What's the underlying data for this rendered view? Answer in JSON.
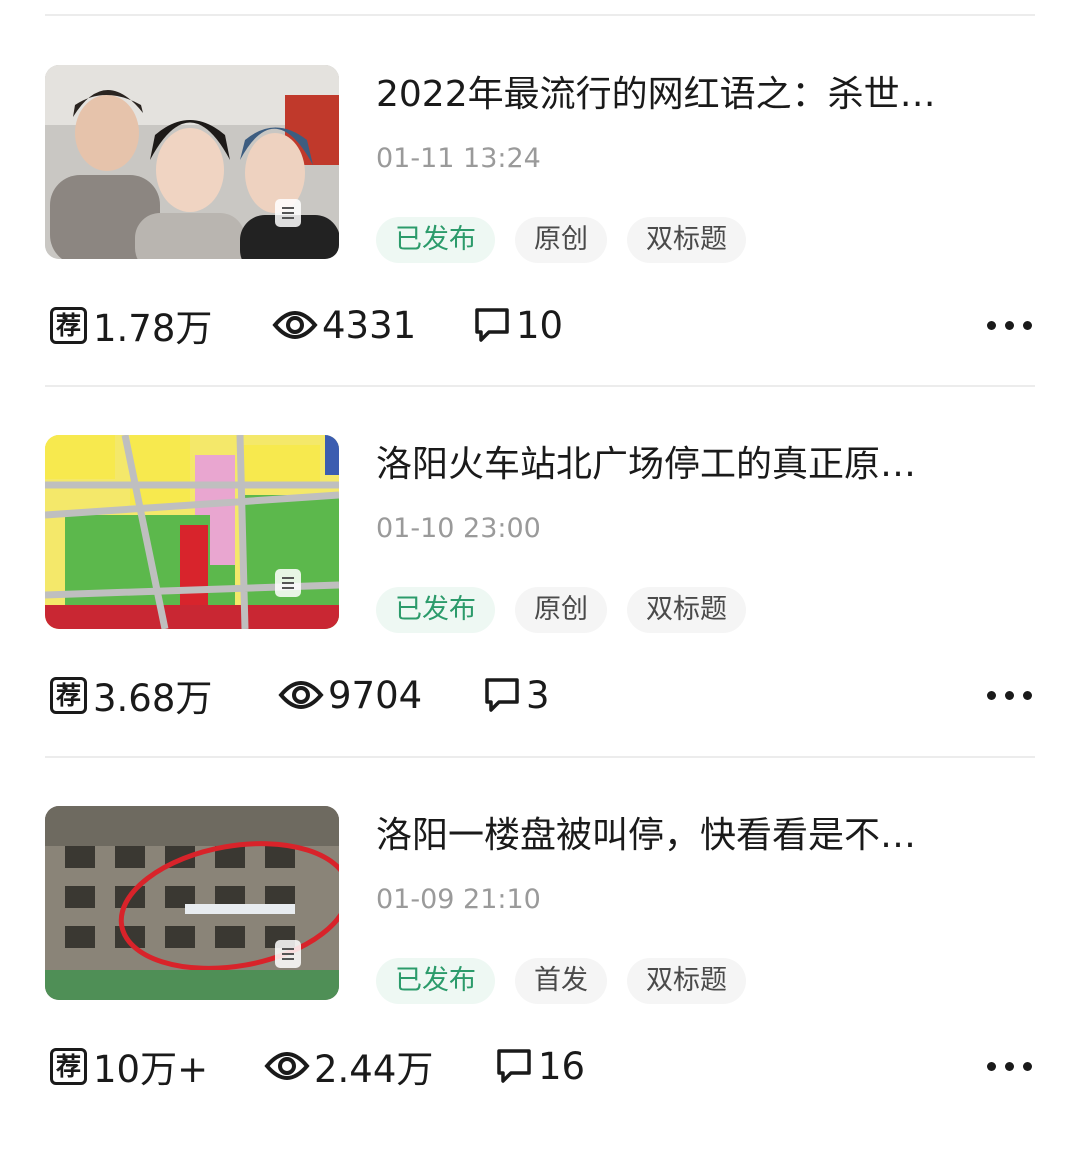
{
  "articles": [
    {
      "title": "2022年最流行的网红语之：杀世…",
      "time": "01-11 13:24",
      "tags": [
        "已发布",
        "原创",
        "双标题"
      ],
      "recommend": "1.78万",
      "views": "4331",
      "comments": "10"
    },
    {
      "title": "洛阳火车站北广场停工的真正原…",
      "time": "01-10 23:00",
      "tags": [
        "已发布",
        "原创",
        "双标题"
      ],
      "recommend": "3.68万",
      "views": "9704",
      "comments": "3"
    },
    {
      "title": "洛阳一楼盘被叫停，快看看是不…",
      "time": "01-09 21:10",
      "tags": [
        "已发布",
        "首发",
        "双标题"
      ],
      "recommend": "10万+",
      "views": "2.44万",
      "comments": "16"
    }
  ],
  "icons": {
    "recommend": "荐",
    "views": "eye-icon",
    "comments": "comment-bubble-icon",
    "more": "more-dots-icon"
  },
  "colors": {
    "published_text": "#2c9b6b",
    "published_bg": "#eef8f3",
    "tag_bg": "#f5f5f5"
  }
}
